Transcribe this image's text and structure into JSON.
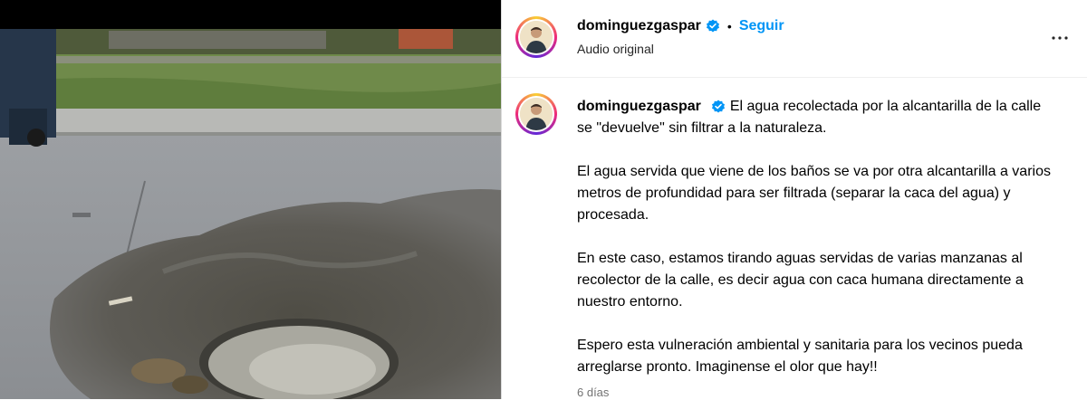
{
  "header": {
    "username": "dominguezgaspar",
    "separator": "•",
    "follow_label": "Seguir",
    "audio_label": "Audio original",
    "more_icon": "more-horizontal-icon",
    "verified_icon": "verified-badge-icon"
  },
  "comment": {
    "username": "dominguezgaspar",
    "paragraphs": [
      "El agua recolectada por la alcantarilla de la calle se \"devuelve\" sin filtrar a la naturaleza.",
      "El agua servida que viene de los baños se va por otra alcantarilla a varios metros de profundidad para ser filtrada (separar la caca del agua) y procesada.",
      "En este caso, estamos tirando aguas servidas de varias manzanas al recolector de la calle, es decir agua con caca humana directamente a nuestro entorno.",
      "Espero esta vulneración ambiental y sanitaria para los vecinos pueda arreglarse pronto. Imaginense el olor que hay!!"
    ],
    "timestamp": "6 días"
  },
  "colors": {
    "accent": "#0095f6",
    "verified": "#0095f6",
    "muted": "#737373"
  }
}
